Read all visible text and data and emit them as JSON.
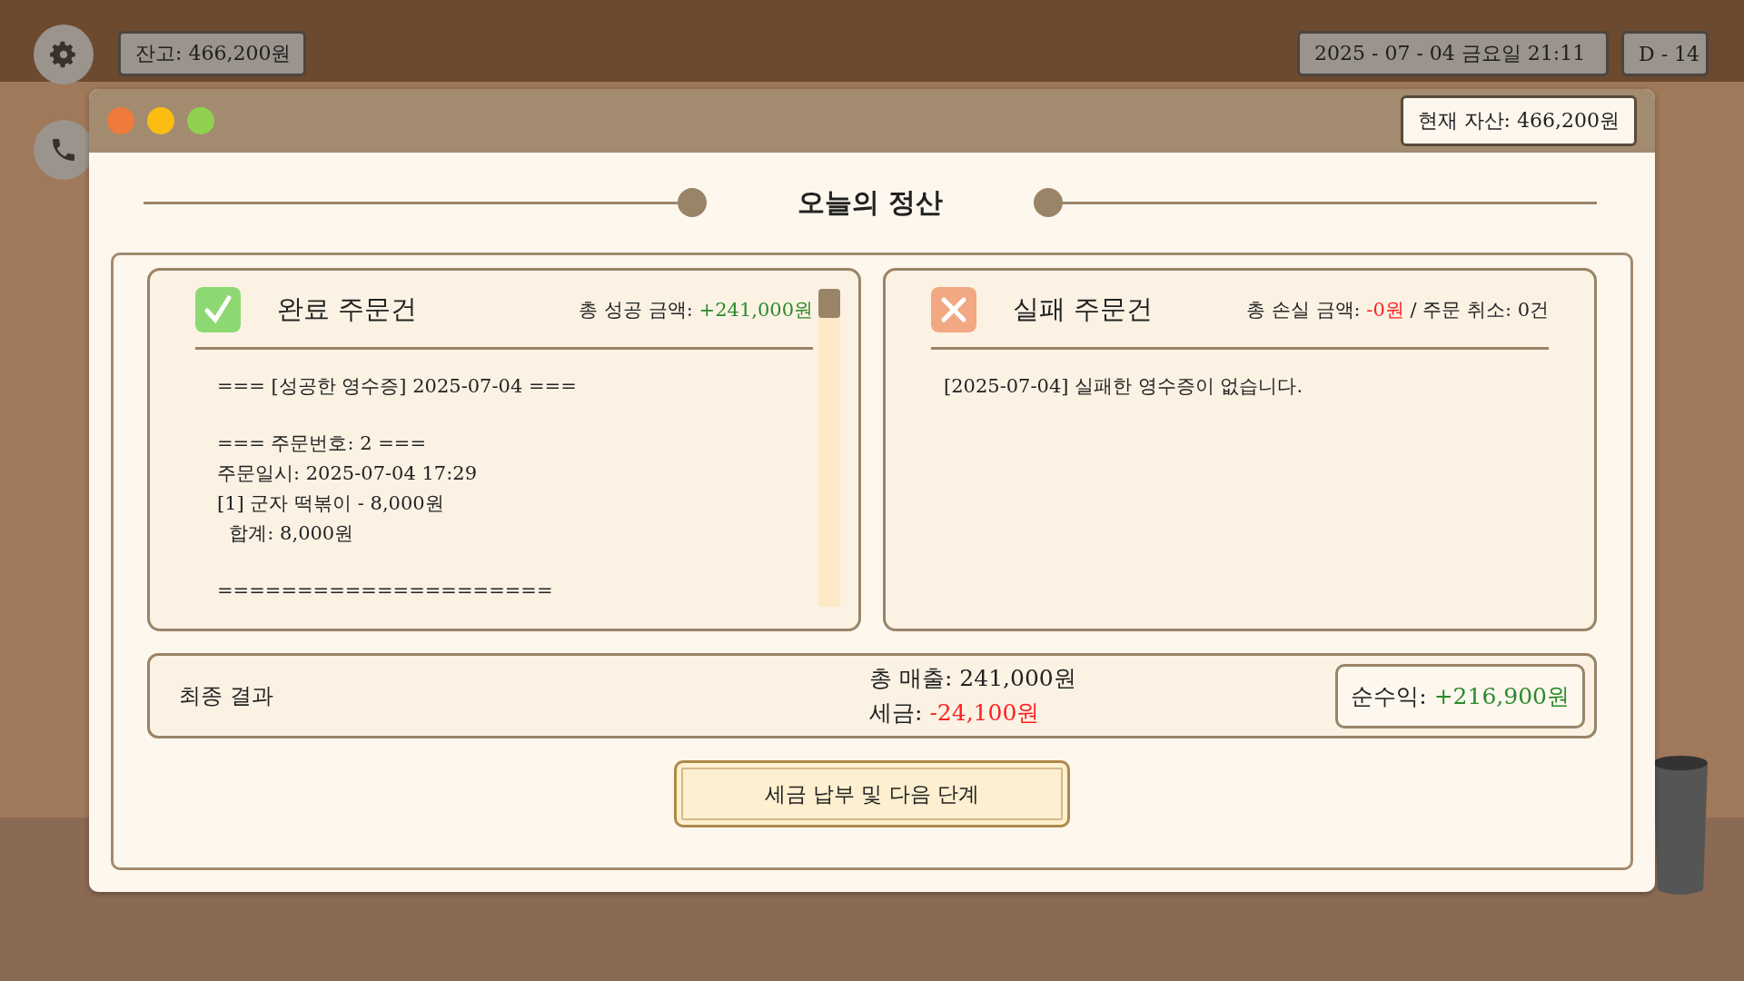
{
  "hud": {
    "balance": "잔고: 466,200원",
    "datetime": "2025 - 07 - 04 금요일 21:11",
    "dday": "D - 14"
  },
  "window": {
    "current_assets": "현재 자산: 466,200원"
  },
  "title": "오늘의 정산",
  "completed": {
    "title": "완료 주문건",
    "total_label": "총 성공 금액: ",
    "total_value": "+241,000원",
    "receipt_blocks": [
      [
        "=== [성공한 영수증] 2025-07-04 ==="
      ],
      [
        "=== 주문번호: 2 ===",
        "주문일시: 2025-07-04 17:29",
        "[1] 군자 떡볶이 - 8,000원",
        "  합계: 8,000원"
      ],
      [
        "====================="
      ]
    ]
  },
  "failed": {
    "title": "실패 주문건",
    "loss_label": "총 손실 금액: ",
    "loss_value": "-0원",
    "cancel_text": " / 주문 취소: 0건",
    "receipt_blocks": [
      [
        "[2025-07-04] 실패한 영수증이 없습니다."
      ]
    ]
  },
  "result": {
    "label": "최종 결과",
    "sales": "총 매출: 241,000원",
    "tax_label": "세금: ",
    "tax_value": "-24,100원",
    "net_label": "순수익: ",
    "net_value": "+216,900원"
  },
  "button": "세금 납부 및 다음 단계"
}
